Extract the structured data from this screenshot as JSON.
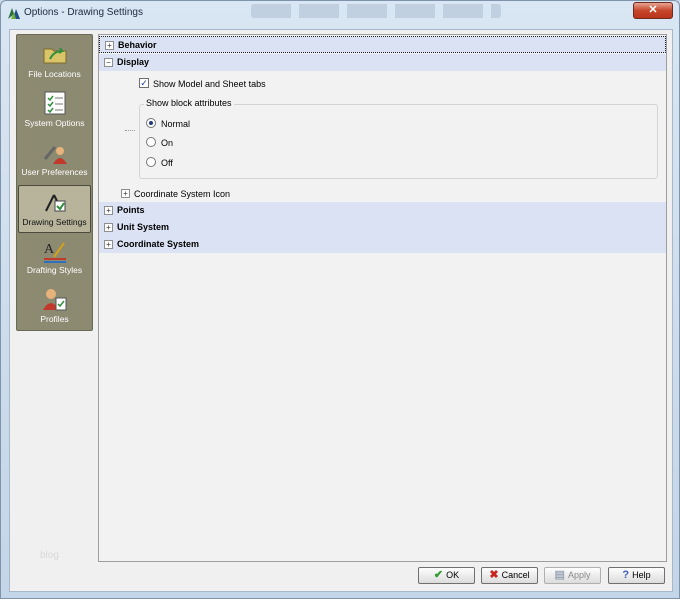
{
  "window": {
    "title": "Options - Drawing Settings",
    "close_label": "✕"
  },
  "sidebar": {
    "items": [
      {
        "label": "File Locations"
      },
      {
        "label": "System Options"
      },
      {
        "label": "User Preferences"
      },
      {
        "label": "Drawing Settings",
        "active": true
      },
      {
        "label": "Drafting Styles"
      },
      {
        "label": "Profiles"
      }
    ]
  },
  "watermark": "blog",
  "settings": {
    "categories": {
      "behavior": "Behavior",
      "display": "Display",
      "points": "Points",
      "unit_system": "Unit System",
      "coordinate_system": "Coordinate System"
    },
    "display": {
      "show_tabs_label": "Show Model and Sheet tabs",
      "show_tabs_checked": true,
      "block_attributes_label": "Show block attributes",
      "block_attributes_options": [
        "Normal",
        "On",
        "Off"
      ],
      "block_attributes_selected": "Normal",
      "coordinate_icon_label": "Coordinate System Icon"
    },
    "expand_plus": "+",
    "expand_minus": "−",
    "check_mark": "✓"
  },
  "buttons": {
    "ok": "OK",
    "cancel": "Cancel",
    "apply": "Apply",
    "help": "Help"
  },
  "colors": {
    "sidebar_bg": "#8d8a72",
    "category_bg": "#dbe2f3",
    "ok_icon": "#2f9a2f",
    "cancel_icon": "#c7251e",
    "help_icon": "#3b5fb5"
  }
}
